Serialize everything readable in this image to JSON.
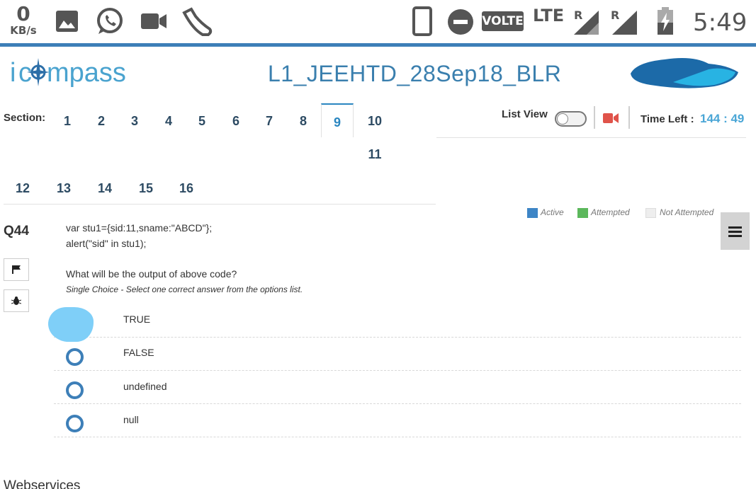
{
  "status_bar": {
    "net_speed_value": "0",
    "net_speed_unit": "KB/s",
    "volte": "VOLTE",
    "lte": "LTE",
    "roaming1": "R",
    "roaming2": "R",
    "time": "5:49",
    "icons": [
      "gallery-icon",
      "whatsapp-icon",
      "video-call-icon",
      "shoe-icon",
      "phone-portrait-icon",
      "do-not-disturb-icon",
      "signal-icon",
      "battery-charging-icon"
    ]
  },
  "header": {
    "logo_text": "icompass",
    "test_title": "L1_JEEHTD_28Sep18_BLR"
  },
  "sections": {
    "label": "Section:",
    "items": [
      "1",
      "2",
      "3",
      "4",
      "5",
      "6",
      "7",
      "8",
      "9",
      "10",
      "11",
      "12",
      "13",
      "14",
      "15",
      "16"
    ],
    "active": "9"
  },
  "controls": {
    "list_view_label": "List View",
    "list_view_on": false,
    "time_left_label": "Time Left :",
    "time_left_value": "144 : 49"
  },
  "legend": {
    "active": "Active",
    "attempted": "Attempted",
    "not_attempted": "Not Attempted",
    "colors": {
      "active": "#3d85c6",
      "attempted": "#5cb85c",
      "not_attempted": "#eeeeee"
    }
  },
  "question": {
    "number": "Q44",
    "code_lines": [
      "var stu1={sid:11,sname:\"ABCD\"};",
      "alert(\"sid\" in stu1);"
    ],
    "text": "What will be the output of above code?",
    "hint": "Single Choice - Select one correct answer from the options list.",
    "options": [
      "TRUE",
      "FALSE",
      "undefined",
      "null"
    ]
  },
  "footer": {
    "next_section_title": "Webservices"
  }
}
